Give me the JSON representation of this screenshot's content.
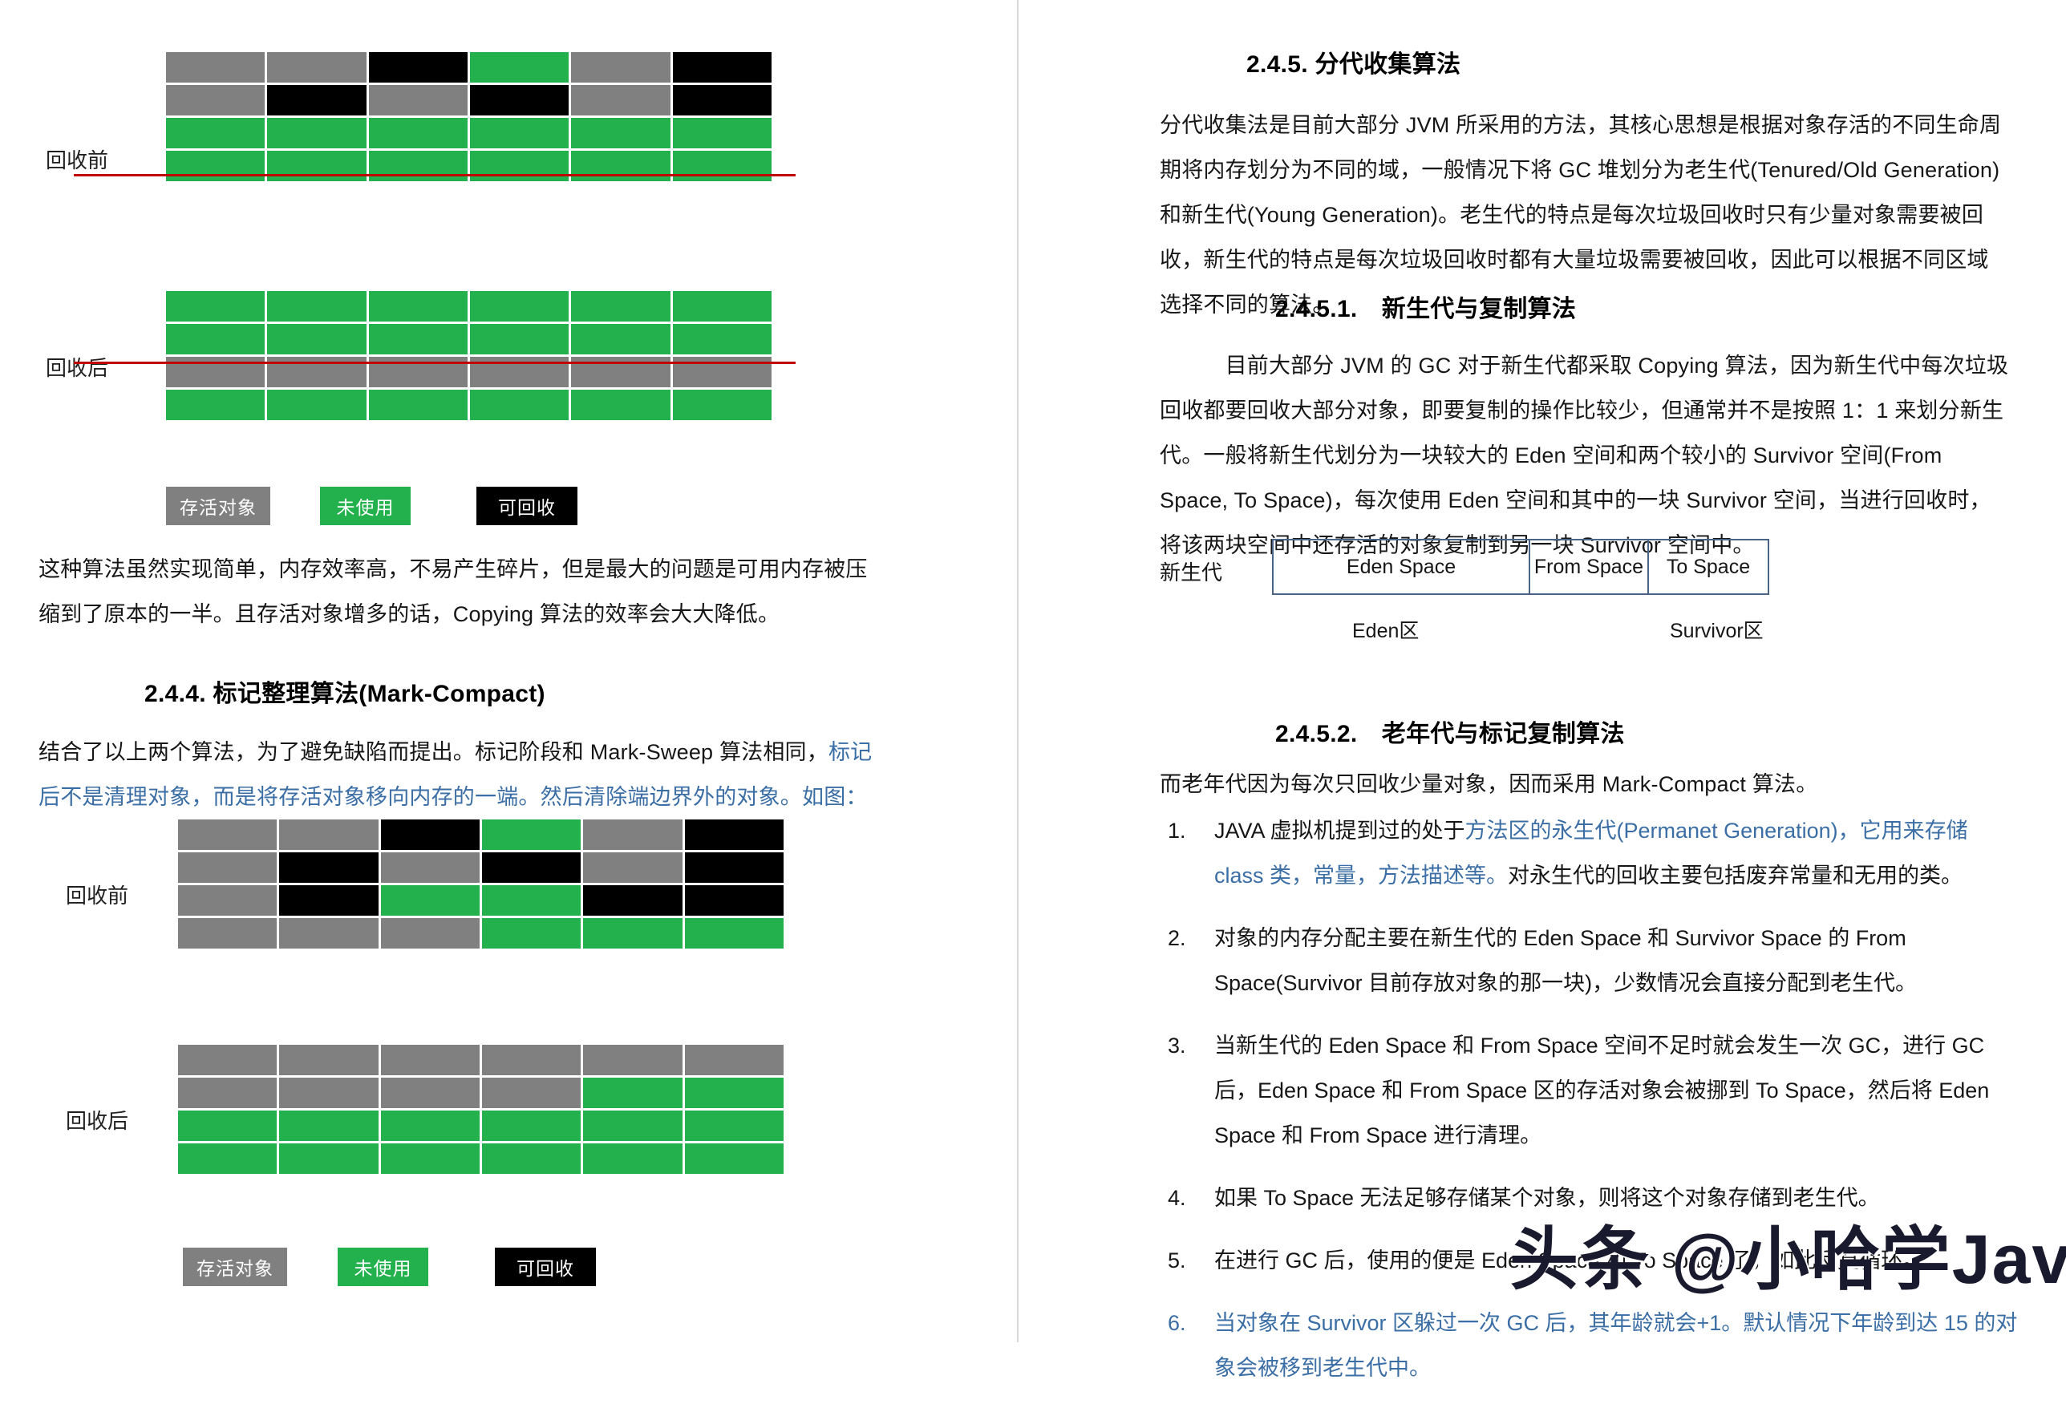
{
  "left": {
    "diagram1": {
      "label": "回收前",
      "rows": [
        [
          "gray",
          "gray",
          "black",
          "green",
          "gray",
          "black"
        ],
        [
          "gray",
          "black",
          "gray",
          "black",
          "gray",
          "black"
        ],
        [
          "green",
          "green",
          "green",
          "green",
          "green",
          "green"
        ],
        [
          "green",
          "green",
          "green",
          "green",
          "green",
          "green"
        ]
      ]
    },
    "diagram2": {
      "label": "回收后",
      "rows": [
        [
          "green",
          "green",
          "green",
          "green",
          "green",
          "green"
        ],
        [
          "green",
          "green",
          "green",
          "green",
          "green",
          "green"
        ],
        [
          "gray",
          "gray",
          "gray",
          "gray",
          "gray",
          "gray"
        ],
        [
          "green",
          "green",
          "green",
          "green",
          "green",
          "green"
        ]
      ]
    },
    "legend1": [
      {
        "label": "存活对象",
        "color": "#808080"
      },
      {
        "label": "未使用",
        "color": "#22b14c"
      },
      {
        "label": "可回收",
        "color": "#000000"
      }
    ],
    "paragraph1": "这种算法虽然实现简单，内存效率高，不易产生碎片，但是最大的问题是可用内存被压缩到了原本的一半。且存活对象增多的话，Copying 算法的效率会大大降低。",
    "heading_244": "2.4.4. 标记整理算法(Mark-Compact)",
    "paragraph2_black": "结合了以上两个算法，为了避免缺陷而提出。标记阶段和 Mark-Sweep 算法相同，",
    "paragraph2_blue": "标记后不是清理对象，而是将存活对象移向内存的一端。然后清除端边界外的对象。如图：",
    "diagram3": {
      "label": "回收前",
      "rows": [
        [
          "gray",
          "gray",
          "black",
          "green",
          "gray",
          "black"
        ],
        [
          "gray",
          "black",
          "gray",
          "black",
          "gray",
          "black"
        ],
        [
          "gray",
          "black",
          "green",
          "green",
          "black",
          "black"
        ],
        [
          "gray",
          "gray",
          "gray",
          "green",
          "green",
          "green"
        ]
      ]
    },
    "diagram4": {
      "label": "回收后",
      "rows": [
        [
          "gray",
          "gray",
          "gray",
          "gray",
          "gray",
          "gray"
        ],
        [
          "gray",
          "gray",
          "gray",
          "gray",
          "green",
          "green"
        ],
        [
          "green",
          "green",
          "green",
          "green",
          "green",
          "green"
        ],
        [
          "green",
          "green",
          "green",
          "green",
          "green",
          "green"
        ]
      ]
    },
    "legend2": [
      {
        "label": "存活对象",
        "color": "#808080"
      },
      {
        "label": "未使用",
        "color": "#22b14c"
      },
      {
        "label": "可回收",
        "color": "#000000"
      }
    ]
  },
  "right": {
    "heading_245": "2.4.5. 分代收集算法",
    "paragraph_245": "分代收集法是目前大部分 JVM 所采用的方法，其核心思想是根据对象存活的不同生命周期将内存划分为不同的域，一般情况下将 GC 堆划分为老生代(Tenured/Old Generation)和新生代(Young Generation)。老生代的特点是每次垃圾回收时只有少量对象需要被回收，新生代的特点是每次垃圾回收时都有大量垃圾需要被回收，因此可以根据不同区域选择不同的算法。",
    "heading_2451": "2.4.5.1.　新生代与复制算法",
    "paragraph_2451": "　　　目前大部分 JVM 的 GC 对于新生代都采取 Copying 算法，因为新生代中每次垃圾回收都要回收大部分对象，即要复制的操作比较少，但通常并不是按照 1：1 来划分新生代。一般将新生代划分为一块较大的 Eden 空间和两个较小的 Survivor 空间(From Space, To Space)，每次使用 Eden 空间和其中的一块 Survivor 空间，当进行回收时，将该两块空间中还存活的对象复制到另一块 Survivor 空间中。",
    "eden_diagram": {
      "side_label": "新生代",
      "segments": [
        {
          "label": "Eden Space"
        },
        {
          "label": "From Space"
        },
        {
          "label": "To Space"
        }
      ],
      "caption_left": "Eden区",
      "caption_right": "Survivor区"
    },
    "heading_2452": "2.4.5.2.　老年代与标记复制算法",
    "paragraph_2452": "而老年代因为每次只回收少量对象，因而采用 Mark-Compact 算法。",
    "list": [
      {
        "marker": "1.",
        "black_prefix": "JAVA 虚拟机提到过的处于",
        "blue": "方法区的永生代(Permanet Generation)，它用来存储 class 类，常量，方法描述等。",
        "black_suffix": "对永生代的回收主要包括废弃常量和无用的类。",
        "all_blue": false
      },
      {
        "marker": "2.",
        "black_prefix": "对象的内存分配主要在新生代的 Eden Space 和 Survivor Space 的 From Space(Survivor 目前存放对象的那一块)，少数情况会直接分配到老生代。",
        "blue": "",
        "black_suffix": "",
        "all_blue": false
      },
      {
        "marker": "3.",
        "black_prefix": "当新生代的 Eden Space 和 From Space 空间不足时就会发生一次 GC，进行 GC 后，Eden Space 和 From Space 区的存活对象会被挪到 To Space，然后将 Eden Space 和 From Space 进行清理。",
        "blue": "",
        "black_suffix": "",
        "all_blue": false
      },
      {
        "marker": "4.",
        "black_prefix": "如果 To Space 无法足够存储某个对象，则将这个对象存储到老生代。",
        "blue": "",
        "black_suffix": "",
        "all_blue": false
      },
      {
        "marker": "5.",
        "black_prefix": "在进行 GC 后，使用的便是 Eden Space 和 To Space 了，如此反复循环。",
        "blue": "",
        "black_suffix": "",
        "all_blue": false
      },
      {
        "marker": "6.",
        "black_prefix": "当对象在 Survivor 区躲过一次 GC 后，其年龄就会+1。",
        "blue": "默认情况下年龄到达 15 的对象会被移到老生代中。",
        "black_suffix": "",
        "all_blue": true
      }
    ],
    "watermark": "头条 @小哈学Java"
  },
  "colors": {
    "alive": "#808080",
    "unused": "#22b14c",
    "recyclable": "#000000",
    "blue_text": "#3b6ea5",
    "red_line": "#c00000",
    "eden_border": "#4a6585"
  }
}
